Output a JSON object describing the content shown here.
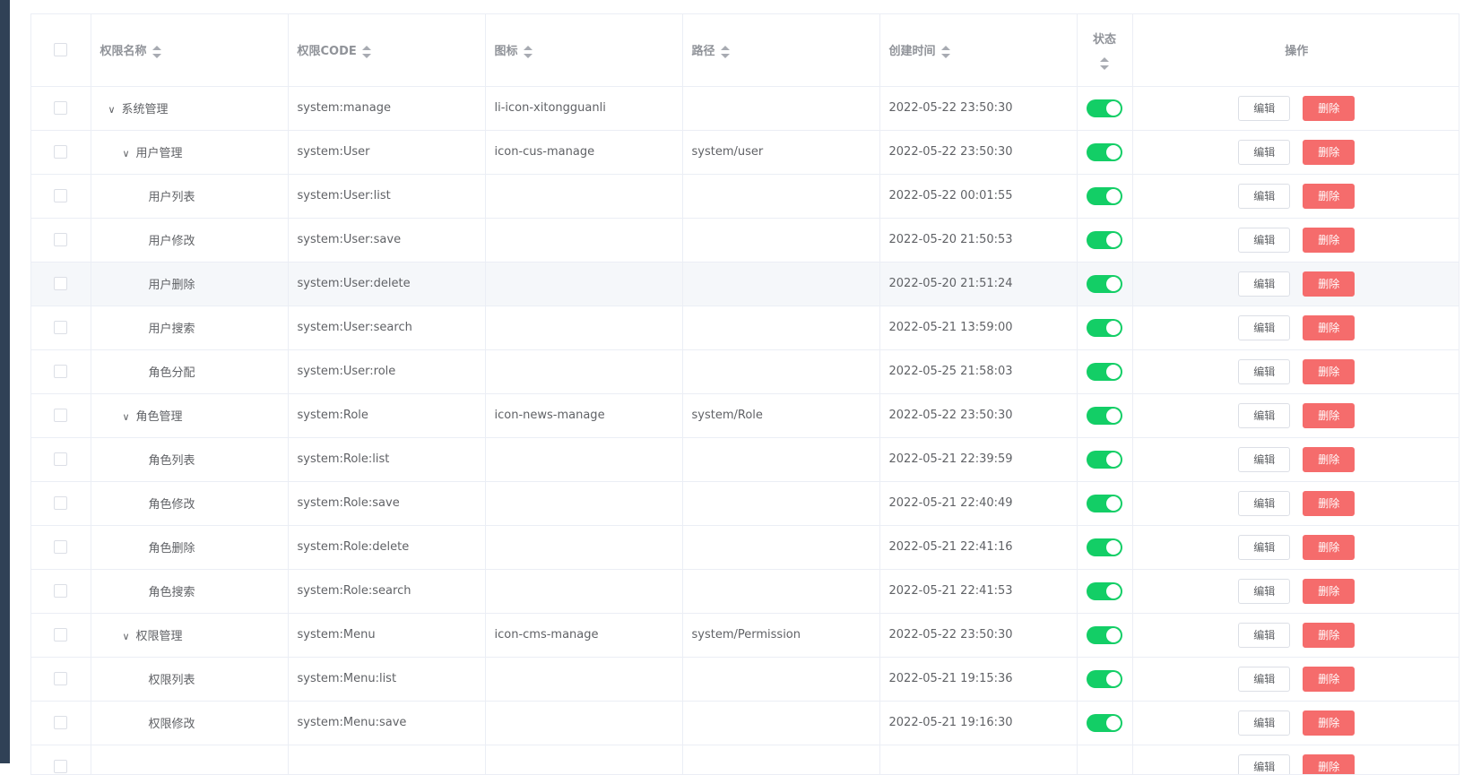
{
  "table": {
    "headers": {
      "name": "权限名称",
      "code": "权限CODE",
      "icon": "图标",
      "path": "路径",
      "created": "创建时间",
      "status": "状态",
      "ops": "操作"
    },
    "edit_label": "编辑",
    "delete_label": "删除",
    "rows": [
      {
        "level": 0,
        "expandable": true,
        "name": "系统管理",
        "code": "system:manage",
        "icon": "li-icon-xitongguanli",
        "path": "",
        "created": "2022-05-22 23:50:30",
        "enabled": true
      },
      {
        "level": 1,
        "expandable": true,
        "name": "用户管理",
        "code": "system:User",
        "icon": "icon-cus-manage",
        "path": "system/user",
        "created": "2022-05-22 23:50:30",
        "enabled": true
      },
      {
        "level": 2,
        "expandable": false,
        "name": "用户列表",
        "code": "system:User:list",
        "icon": "",
        "path": "",
        "created": "2022-05-22 00:01:55",
        "enabled": true
      },
      {
        "level": 2,
        "expandable": false,
        "name": "用户修改",
        "code": "system:User:save",
        "icon": "",
        "path": "",
        "created": "2022-05-20 21:50:53",
        "enabled": true
      },
      {
        "level": 2,
        "expandable": false,
        "name": "用户删除",
        "code": "system:User:delete",
        "icon": "",
        "path": "",
        "created": "2022-05-20 21:51:24",
        "enabled": true,
        "hover": true
      },
      {
        "level": 2,
        "expandable": false,
        "name": "用户搜索",
        "code": "system:User:search",
        "icon": "",
        "path": "",
        "created": "2022-05-21 13:59:00",
        "enabled": true
      },
      {
        "level": 2,
        "expandable": false,
        "name": "角色分配",
        "code": "system:User:role",
        "icon": "",
        "path": "",
        "created": "2022-05-25 21:58:03",
        "enabled": true
      },
      {
        "level": 1,
        "expandable": true,
        "name": "角色管理",
        "code": "system:Role",
        "icon": "icon-news-manage",
        "path": "system/Role",
        "created": "2022-05-22 23:50:30",
        "enabled": true
      },
      {
        "level": 2,
        "expandable": false,
        "name": "角色列表",
        "code": "system:Role:list",
        "icon": "",
        "path": "",
        "created": "2022-05-21 22:39:59",
        "enabled": true
      },
      {
        "level": 2,
        "expandable": false,
        "name": "角色修改",
        "code": "system:Role:save",
        "icon": "",
        "path": "",
        "created": "2022-05-21 22:40:49",
        "enabled": true
      },
      {
        "level": 2,
        "expandable": false,
        "name": "角色删除",
        "code": "system:Role:delete",
        "icon": "",
        "path": "",
        "created": "2022-05-21 22:41:16",
        "enabled": true
      },
      {
        "level": 2,
        "expandable": false,
        "name": "角色搜索",
        "code": "system:Role:search",
        "icon": "",
        "path": "",
        "created": "2022-05-21 22:41:53",
        "enabled": true
      },
      {
        "level": 1,
        "expandable": true,
        "name": "权限管理",
        "code": "system:Menu",
        "icon": "icon-cms-manage",
        "path": "system/Permission",
        "created": "2022-05-22 23:50:30",
        "enabled": true
      },
      {
        "level": 2,
        "expandable": false,
        "name": "权限列表",
        "code": "system:Menu:list",
        "icon": "",
        "path": "",
        "created": "2022-05-21 19:15:36",
        "enabled": true
      },
      {
        "level": 2,
        "expandable": false,
        "name": "权限修改",
        "code": "system:Menu:save",
        "icon": "",
        "path": "",
        "created": "2022-05-21 19:16:30",
        "enabled": true
      },
      {
        "level": 2,
        "expandable": false,
        "name": "",
        "code": "",
        "icon": "",
        "path": "",
        "created": "",
        "enabled": true
      }
    ]
  },
  "colors": {
    "sidebar": "#304156",
    "switch_on": "#13ce66",
    "danger": "#f56c6c",
    "border": "#ebeef5",
    "hover_row": "#f5f7fa"
  }
}
